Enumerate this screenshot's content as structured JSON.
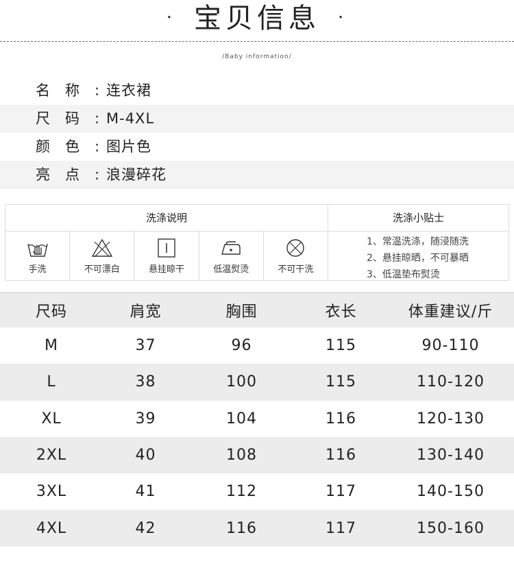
{
  "header": {
    "title": "宝贝信息",
    "dot": "·",
    "subtitle": "/Baby information/"
  },
  "info": [
    {
      "key": "名称:",
      "value": "连衣裙"
    },
    {
      "key": "尺码:",
      "value": "M-4XL"
    },
    {
      "key": "颜色:",
      "value": "图片色"
    },
    {
      "key": "亮点:",
      "value": "浪漫碎花"
    }
  ],
  "care": {
    "instructions_title": "洗涤说明",
    "tips_title": "洗涤小贴士",
    "icons": [
      {
        "icon": "hand-wash-icon",
        "label": "手洗"
      },
      {
        "icon": "no-bleach-icon",
        "label": "不可漂白"
      },
      {
        "icon": "hang-dry-icon",
        "label": "悬挂晾干"
      },
      {
        "icon": "low-iron-icon",
        "label": "低温熨烫"
      },
      {
        "icon": "no-dry-clean-icon",
        "label": "不可干洗"
      }
    ],
    "tips": [
      "1、常温洗涤，随浸随洗",
      "2、悬挂晾晒，不可暴晒",
      "3、低温垫布熨烫"
    ]
  },
  "size_table": {
    "headers": [
      "尺码",
      "肩宽",
      "胸围",
      "衣长",
      "体重建议/斤"
    ],
    "rows": [
      [
        "M",
        "37",
        "96",
        "115",
        "90-110"
      ],
      [
        "L",
        "38",
        "100",
        "115",
        "110-120"
      ],
      [
        "XL",
        "39",
        "104",
        "116",
        "120-130"
      ],
      [
        "2XL",
        "40",
        "108",
        "116",
        "130-140"
      ],
      [
        "3XL",
        "41",
        "112",
        "117",
        "140-150"
      ],
      [
        "4XL",
        "42",
        "116",
        "117",
        "150-160"
      ]
    ]
  }
}
